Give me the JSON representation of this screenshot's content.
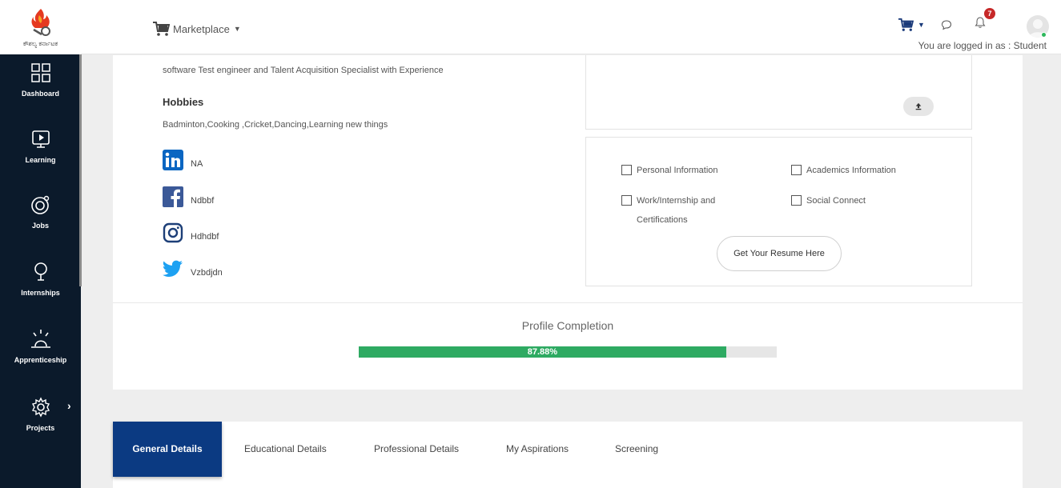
{
  "brand": {
    "logo_text": "ಕೌಶಲ್ಯ ಕರ್ನಾಟಕ"
  },
  "sidebar": {
    "items": [
      {
        "label": "Dashboard",
        "icon": "dashboard-grid-icon"
      },
      {
        "label": "Learning",
        "icon": "monitor-play-icon"
      },
      {
        "label": "Jobs",
        "icon": "jobs-target-icon"
      },
      {
        "label": "Internships",
        "icon": "lightbulb-icon"
      },
      {
        "label": "Apprenticeship",
        "icon": "sunrise-icon"
      },
      {
        "label": "Projects",
        "icon": "gear-icon"
      }
    ],
    "background": "#0b1a2b"
  },
  "header": {
    "marketplace_label": "Marketplace",
    "notification_count": "7",
    "logged_in_text": "You are logged in as : Student"
  },
  "profile": {
    "about": "software Test engineer and Talent Acquisition Specialist with Experience",
    "hobbies_title": "Hobbies",
    "hobbies": "Badminton,Cooking ,Cricket,Dancing,Learning new things",
    "social": {
      "linkedin": "NA",
      "facebook": "Ndbbf",
      "instagram": "Hdhdbf",
      "twitter": "Vzbdjdn"
    }
  },
  "resume": {
    "options": [
      {
        "label": "Personal Information",
        "checked": false
      },
      {
        "label": "Academics Information",
        "checked": false
      },
      {
        "label": "Work/Internship and Certifications",
        "checked": false
      },
      {
        "label": "Social Connect",
        "checked": false
      }
    ],
    "button_label": "Get Your Resume Here"
  },
  "profile_completion": {
    "title": "Profile Completion",
    "percent": 87.88,
    "label": "87.88%",
    "color": "#2eaa62"
  },
  "tabs": [
    {
      "label": "General Details",
      "active": true
    },
    {
      "label": "Educational Details",
      "active": false
    },
    {
      "label": "Professional Details",
      "active": false
    },
    {
      "label": "My Aspirations",
      "active": false
    },
    {
      "label": "Screening",
      "active": false
    }
  ],
  "colors": {
    "accent": "#0b3a82",
    "progress": "#2eaa62",
    "badge": "#c62828"
  }
}
